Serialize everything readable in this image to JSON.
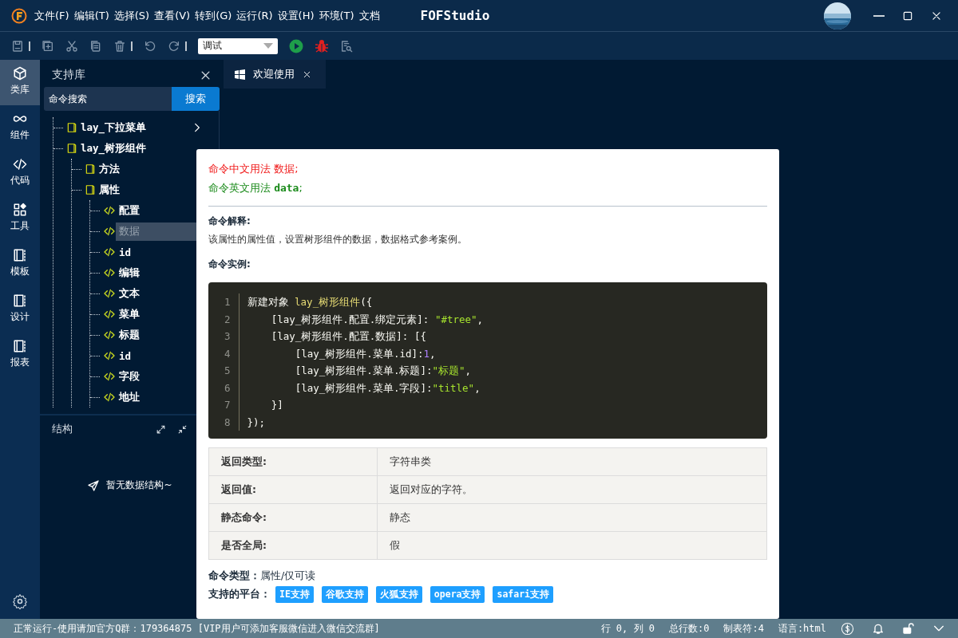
{
  "window": {
    "menu": [
      "文件(F)",
      "编辑(T)",
      "选择(S)",
      "查看(V)",
      "转到(G)",
      "运行(R)",
      "设置(H)",
      "环境(T)",
      "文档"
    ],
    "title": "FOFStudio"
  },
  "toolbar": {
    "mode_select": {
      "value": "调试"
    }
  },
  "activity_bar": [
    {
      "label": "类库",
      "kind": "cube",
      "selected": true
    },
    {
      "label": "组件",
      "kind": "infinity",
      "selected": false
    },
    {
      "label": "代码",
      "kind": "code",
      "selected": false
    },
    {
      "label": "工具",
      "kind": "tools",
      "selected": false
    },
    {
      "label": "模板",
      "kind": "panel",
      "selected": false
    },
    {
      "label": "设计",
      "kind": "panel",
      "selected": false
    },
    {
      "label": "报表",
      "kind": "panel",
      "selected": false
    }
  ],
  "library_panel": {
    "title": "支持库",
    "search": {
      "placeholder": "命令搜索",
      "button": "搜索"
    },
    "tree": [
      {
        "label": "lay_下拉菜单",
        "kind": "book",
        "selected": false
      },
      {
        "label": "lay_树形组件",
        "kind": "book",
        "selected": false,
        "children": [
          {
            "label": "方法",
            "kind": "book",
            "selected": false
          },
          {
            "label": "属性",
            "kind": "book",
            "selected": false,
            "children": [
              {
                "label": "配置",
                "kind": "code",
                "selected": false
              },
              {
                "label": "数据",
                "kind": "code",
                "selected": true
              },
              {
                "label": "id",
                "kind": "code",
                "selected": false
              },
              {
                "label": "编辑",
                "kind": "code",
                "selected": false
              },
              {
                "label": "文本",
                "kind": "code",
                "selected": false
              },
              {
                "label": "菜单",
                "kind": "code",
                "selected": false
              },
              {
                "label": "标题",
                "kind": "code",
                "selected": false
              },
              {
                "label": "id",
                "kind": "code",
                "selected": false
              },
              {
                "label": "字段",
                "kind": "code",
                "selected": false
              },
              {
                "label": "地址",
                "kind": "code",
                "selected": false
              }
            ]
          }
        ]
      }
    ]
  },
  "structure_panel": {
    "title": "结构",
    "empty_text": "暂无数据结构~"
  },
  "tabs": [
    {
      "label": "欢迎使用",
      "selected": true
    }
  ],
  "popup": {
    "chinese_usage": "命令中文用法  数据;",
    "english_usage": "命令英文用法 **data**;",
    "explanation_heading": "命令解释:",
    "explanation": "该属性的属性值，设置树形组件的数据，数据格式参考案例。",
    "example_heading": "命令实例:",
    "code": [
      {
        "number": "1",
        "tokens": [
          {
            "text": "新建对象 ",
            "kind": "plain"
          },
          {
            "text": "lay_树形组件",
            "kind": "name"
          },
          {
            "text": "({",
            "kind": "plain"
          }
        ]
      },
      {
        "number": "2",
        "tokens": [
          {
            "text": "    [lay_树形组件.配置.绑定元素]: ",
            "kind": "plain"
          },
          {
            "text": "\"#tree\"",
            "kind": "string"
          },
          {
            "text": ",",
            "kind": "plain"
          }
        ]
      },
      {
        "number": "3",
        "tokens": [
          {
            "text": "    [lay_树形组件.配置.数据]: [{",
            "kind": "plain"
          }
        ]
      },
      {
        "number": "4",
        "tokens": [
          {
            "text": "        [lay_树形组件.菜单.id]:",
            "kind": "plain"
          },
          {
            "text": "1",
            "kind": "number"
          },
          {
            "text": ",",
            "kind": "plain"
          }
        ]
      },
      {
        "number": "5",
        "tokens": [
          {
            "text": "        [lay_树形组件.菜单.标题]:",
            "kind": "plain"
          },
          {
            "text": "\"标题\"",
            "kind": "string"
          },
          {
            "text": ",",
            "kind": "plain"
          }
        ]
      },
      {
        "number": "6",
        "tokens": [
          {
            "text": "        [lay_树形组件.菜单.字段]:",
            "kind": "plain"
          },
          {
            "text": "\"title\"",
            "kind": "string"
          },
          {
            "text": ",",
            "kind": "plain"
          }
        ]
      },
      {
        "number": "7",
        "tokens": [
          {
            "text": "    }]",
            "kind": "plain"
          }
        ]
      },
      {
        "number": "8",
        "tokens": [
          {
            "text": "});",
            "kind": "plain"
          }
        ]
      }
    ],
    "table": [
      {
        "label": "返回类型:",
        "value": "字符串类"
      },
      {
        "label": "返回值:",
        "value": "返回对应的字符。"
      },
      {
        "label": "静态命令:",
        "value": "静态"
      },
      {
        "label": "是否全局:",
        "value": "假"
      }
    ],
    "command_type": "**命令类型：**属性/仅可读",
    "platforms_label": "支持的平台：",
    "platforms": [
      "IE支持",
      "谷歌支持",
      "火狐支持",
      "opera支持",
      "safari支持"
    ]
  },
  "status_bar": {
    "message": "正常运行-使用请加官方Q群：179364875 [VIP用户可添加客服微信进入微信交流群]",
    "position": "行 0, 列 0",
    "total_lines": "总行数:0",
    "tab_size": "制表符:4",
    "language": "语言:html"
  }
}
